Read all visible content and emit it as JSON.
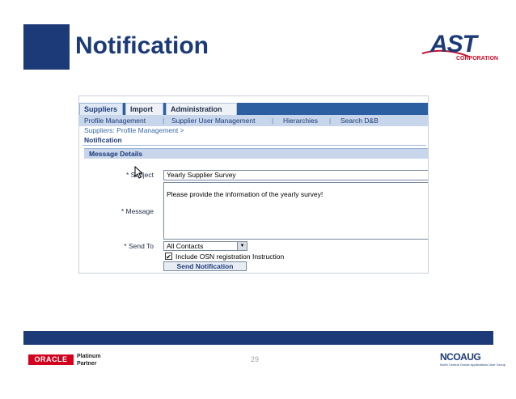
{
  "slide": {
    "title": "Notification",
    "page_number": "29",
    "accent_color": "#1c3a78"
  },
  "logos": {
    "ast": {
      "main": "AST",
      "sub": "CORPORATION"
    },
    "oracle": {
      "badge": "ORACLE",
      "line1": "Platinum",
      "line2": "Partner"
    },
    "ncoaug": {
      "main": "NCOAUG",
      "sub": "North Central Oracle Applications User Group"
    }
  },
  "app": {
    "tabs": [
      "Suppliers",
      "Import",
      "Administration"
    ],
    "active_tab": "Suppliers",
    "subnav": [
      "Profile Management",
      "Supplier User Management",
      "Hierarchies",
      "Search D&B"
    ],
    "subnav_sep": "|",
    "breadcrumb": "Suppliers: Profile Management  >",
    "page_heading": "Notification",
    "section_title": "Message Details",
    "form": {
      "subject_label": "* Subject",
      "subject_value": "Yearly Supplier Survey",
      "message_label": "* Message",
      "message_value": "Please provide the information of the yearly survey!",
      "send_to_label": "* Send To",
      "send_to_value": "All Contacts",
      "checkbox_label": "Include OSN registration Instruction",
      "checkbox_checked": true,
      "send_button": "Send Notification"
    }
  }
}
